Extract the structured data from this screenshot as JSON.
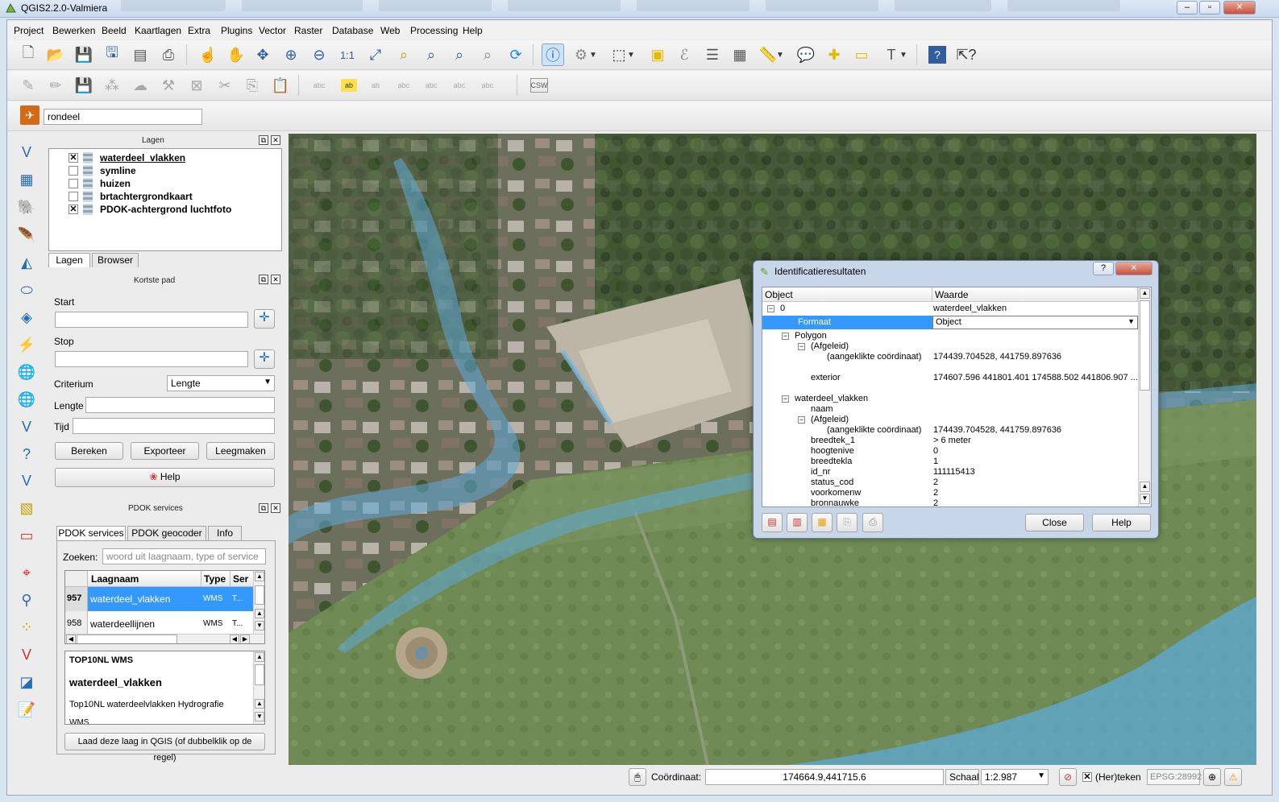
{
  "window": {
    "title": "QGIS2.2.0-Valmiera"
  },
  "menu": [
    "Project",
    "Bewerken",
    "Beeld",
    "Kaartlagen",
    "Extra",
    "Plugins",
    "Vector",
    "Raster",
    "Database",
    "Web",
    "Processing",
    "Help"
  ],
  "toolbar3": {
    "search_value": "rondeel"
  },
  "layers_panel": {
    "title": "Lagen",
    "items": [
      {
        "label": "waterdeel_vlakken",
        "checked": true,
        "selected": true
      },
      {
        "label": "symline",
        "checked": false
      },
      {
        "label": "huizen",
        "checked": false
      },
      {
        "label": "brtachtergrondkaart",
        "checked": false
      },
      {
        "label": "PDOK-achtergrond luchtfoto",
        "checked": true
      }
    ],
    "tabs": [
      "Lagen",
      "Browser"
    ]
  },
  "shortest_path": {
    "title": "Kortste pad",
    "start_label": "Start",
    "stop_label": "Stop",
    "criterium_label": "Criterium",
    "criterium_value": "Lengte",
    "lengte_label": "Lengte",
    "tijd_label": "Tijd",
    "btn_calc": "Bereken",
    "btn_export": "Exporteer",
    "btn_clear": "Leegmaken",
    "btn_help": "Help"
  },
  "pdok": {
    "title": "PDOK services",
    "tabs": [
      "PDOK services",
      "PDOK geocoder",
      "Info"
    ],
    "search_label": "Zoeken:",
    "search_placeholder": "woord uit laagnaam, type of service",
    "columns": [
      "Laagnaam",
      "Type",
      "Ser"
    ],
    "rows": [
      {
        "num": "957",
        "name": "waterdeel_vlakken",
        "type": "WMS",
        "ser": "T..."
      },
      {
        "num": "958",
        "name": "waterdeellijnen",
        "type": "WMS",
        "ser": "T..."
      }
    ],
    "info_heading": "TOP10NL WMS",
    "info_title": "waterdeel_vlakken",
    "info_desc": "Top10NL waterdeelvlakken Hydrografie",
    "info_cut": "WMS",
    "load_button": "Laad deze laag in QGIS (of dubbelklik op de regel)"
  },
  "identify": {
    "title": "Identificatieresultaten",
    "col_object": "Object",
    "col_value": "Waarde",
    "rows": [
      {
        "k": "0",
        "v": "waterdeel_vlakken"
      },
      {
        "k": "Formaat",
        "v": "Object"
      },
      {
        "k": "Polygon",
        "v": ""
      },
      {
        "k": "(Afgeleid)",
        "v": ""
      },
      {
        "k": "(aangeklikte coördinaat)",
        "v": "174439.704528, 441759.897636"
      },
      {
        "k": "exterior",
        "v": "174607.596 441801.401 174588.502 441806.907 ..."
      },
      {
        "k": "waterdeel_vlakken",
        "v": ""
      },
      {
        "k": "naam",
        "v": ""
      },
      {
        "k": "(Afgeleid)",
        "v": ""
      },
      {
        "k": "(aangeklikte coördinaat)",
        "v": "174439.704528, 441759.897636"
      },
      {
        "k": "breedtek_1",
        "v": "> 6 meter"
      },
      {
        "k": "hoogtenive",
        "v": "0"
      },
      {
        "k": "breedtekla",
        "v": "1"
      },
      {
        "k": "id_nr",
        "v": "111115413"
      },
      {
        "k": "status_cod",
        "v": "2"
      },
      {
        "k": "voorkomenw",
        "v": "2"
      },
      {
        "k": "bronnauwke",
        "v": "2"
      }
    ],
    "btn_close": "Close",
    "btn_help": "Help"
  },
  "statusbar": {
    "coord_label": "Coördinaat:",
    "coord_value": "174664.9,441715.6",
    "scale_label": "Schaal",
    "scale_value": "1:2.987",
    "render_label": "(Her)teken",
    "epsg": "EPSG:28992"
  },
  "colors": {
    "selection": "#3399ff",
    "water_overlay": "#5ea9d8",
    "accent": "#2f5d9e"
  }
}
